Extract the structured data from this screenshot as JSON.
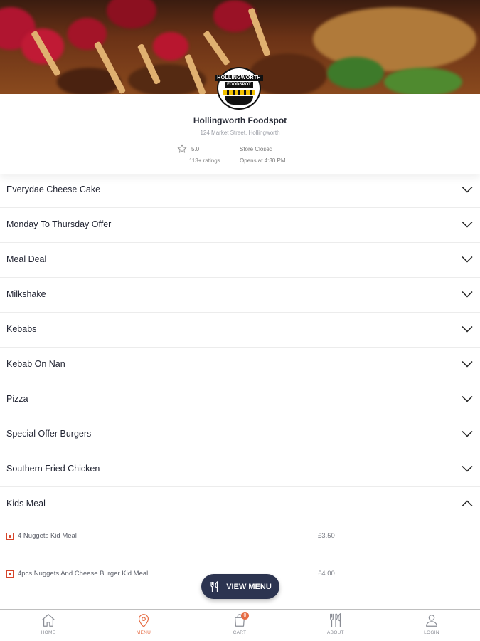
{
  "store": {
    "name": "Hollingworth Foodspot",
    "address": "124 Market Street, Hollingworth",
    "rating": "5.0",
    "ratings_count": "113+ ratings",
    "status": "Store Closed",
    "opens_at": "Opens at 4:30 PM",
    "logo_text_1": "HOLLINGWORTH",
    "logo_text_2": "FOODSPOT"
  },
  "categories": [
    {
      "label": "Everydae Cheese Cake",
      "expanded": false
    },
    {
      "label": "Monday To Thursday Offer",
      "expanded": false
    },
    {
      "label": "Meal Deal",
      "expanded": false
    },
    {
      "label": "Milkshake",
      "expanded": false
    },
    {
      "label": "Kebabs",
      "expanded": false
    },
    {
      "label": "Kebab On Nan",
      "expanded": false
    },
    {
      "label": "Pizza",
      "expanded": false
    },
    {
      "label": "Special Offer Burgers",
      "expanded": false
    },
    {
      "label": "Southern Fried Chicken",
      "expanded": false
    },
    {
      "label": "Kids Meal",
      "expanded": true
    }
  ],
  "kids_meal_items": [
    {
      "name": "4 Nuggets Kid Meal",
      "price": "£3.50"
    },
    {
      "name": "4pcs Nuggets And Cheese Burger Kid Meal",
      "price": "£4.00"
    }
  ],
  "view_menu_label": "VIEW MENU",
  "nav": {
    "home": "HOME",
    "menu": "MENU",
    "cart": "CART",
    "cart_count": "0",
    "about": "ABOUT",
    "login": "LOGIN"
  },
  "colors": {
    "accent": "#e66c44",
    "button": "#2c3450",
    "text": "#1f2230"
  }
}
